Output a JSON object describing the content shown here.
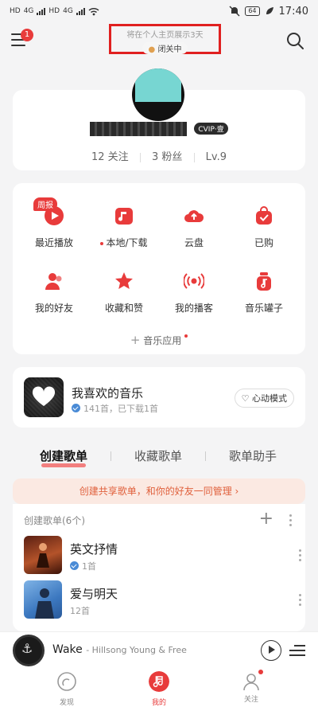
{
  "status_bar": {
    "left_labels": [
      "HD",
      "4G",
      "HD",
      "4G"
    ],
    "battery": "64",
    "time": "17:40"
  },
  "header": {
    "menu_badge": "1",
    "privacy_hint": "将在个人主页展示3天",
    "privacy_status": "闭关中"
  },
  "profile": {
    "vip_label": "CVIP·壹",
    "follows": "12 关注",
    "fans": "3 粉丝",
    "level": "Lv.9"
  },
  "shortcuts": {
    "items": [
      {
        "label": "最近播放",
        "badge": "周报",
        "icon": "recent-play-icon"
      },
      {
        "label": "本地/下载",
        "icon": "local-download-icon"
      },
      {
        "label": "云盘",
        "icon": "cloud-disk-icon"
      },
      {
        "label": "已购",
        "icon": "purchased-icon"
      },
      {
        "label": "我的好友",
        "icon": "friends-icon"
      },
      {
        "label": "收藏和赞",
        "icon": "star-icon"
      },
      {
        "label": "我的播客",
        "icon": "podcast-icon"
      },
      {
        "label": "音乐罐子",
        "icon": "music-jar-icon"
      }
    ],
    "apps_label": "音乐应用"
  },
  "favorite": {
    "title": "我喜欢的音乐",
    "subtitle": "141首，已下载1首",
    "mode_button": "心动模式"
  },
  "playlist_tabs": [
    "创建歌单",
    "收藏歌单",
    "歌单助手"
  ],
  "share_banner": "创建共享歌单，和你的好友一同管理 ›",
  "created_lists": {
    "header": "创建歌单(6个)",
    "items": [
      {
        "title": "英文抒情",
        "subtitle": "1首",
        "verified": true
      },
      {
        "title": "爱与明天",
        "subtitle": "12首",
        "verified": false
      }
    ]
  },
  "player": {
    "song": "Wake",
    "artist": "- Hillsong Young & Free"
  },
  "bottom_nav": {
    "items": [
      {
        "label": "发现"
      },
      {
        "label": "我的"
      },
      {
        "label": "关注"
      }
    ]
  },
  "colors": {
    "accent": "#e83b3b",
    "highlight_border": "#e02020",
    "banner_text": "#e0603c",
    "banner_bg": "#fbe9e2"
  }
}
